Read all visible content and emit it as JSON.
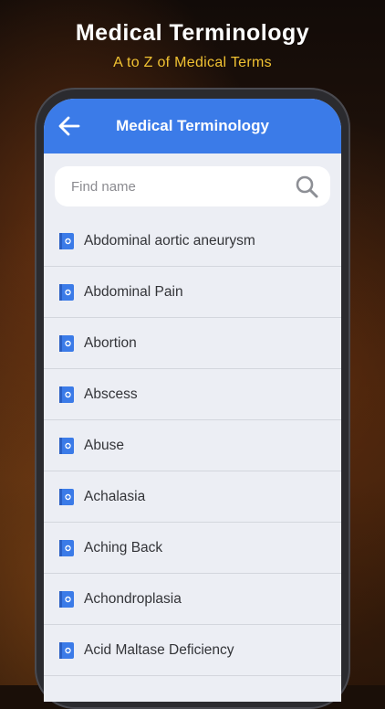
{
  "promo": {
    "title": "Medical Terminology",
    "subtitle": "A to Z of Medical Terms"
  },
  "app": {
    "title": "Medical Terminology",
    "accent_color": "#3b7be8",
    "back_icon": "arrow-left-icon",
    "search": {
      "placeholder": "Find name",
      "icon": "search-icon"
    },
    "list_icon": "medical-book-icon",
    "terms": [
      "Abdominal aortic aneurysm",
      "Abdominal Pain",
      "Abortion",
      "Abscess",
      "Abuse",
      "Achalasia",
      "Aching Back",
      "Achondroplasia",
      "Acid Maltase Deficiency"
    ]
  }
}
